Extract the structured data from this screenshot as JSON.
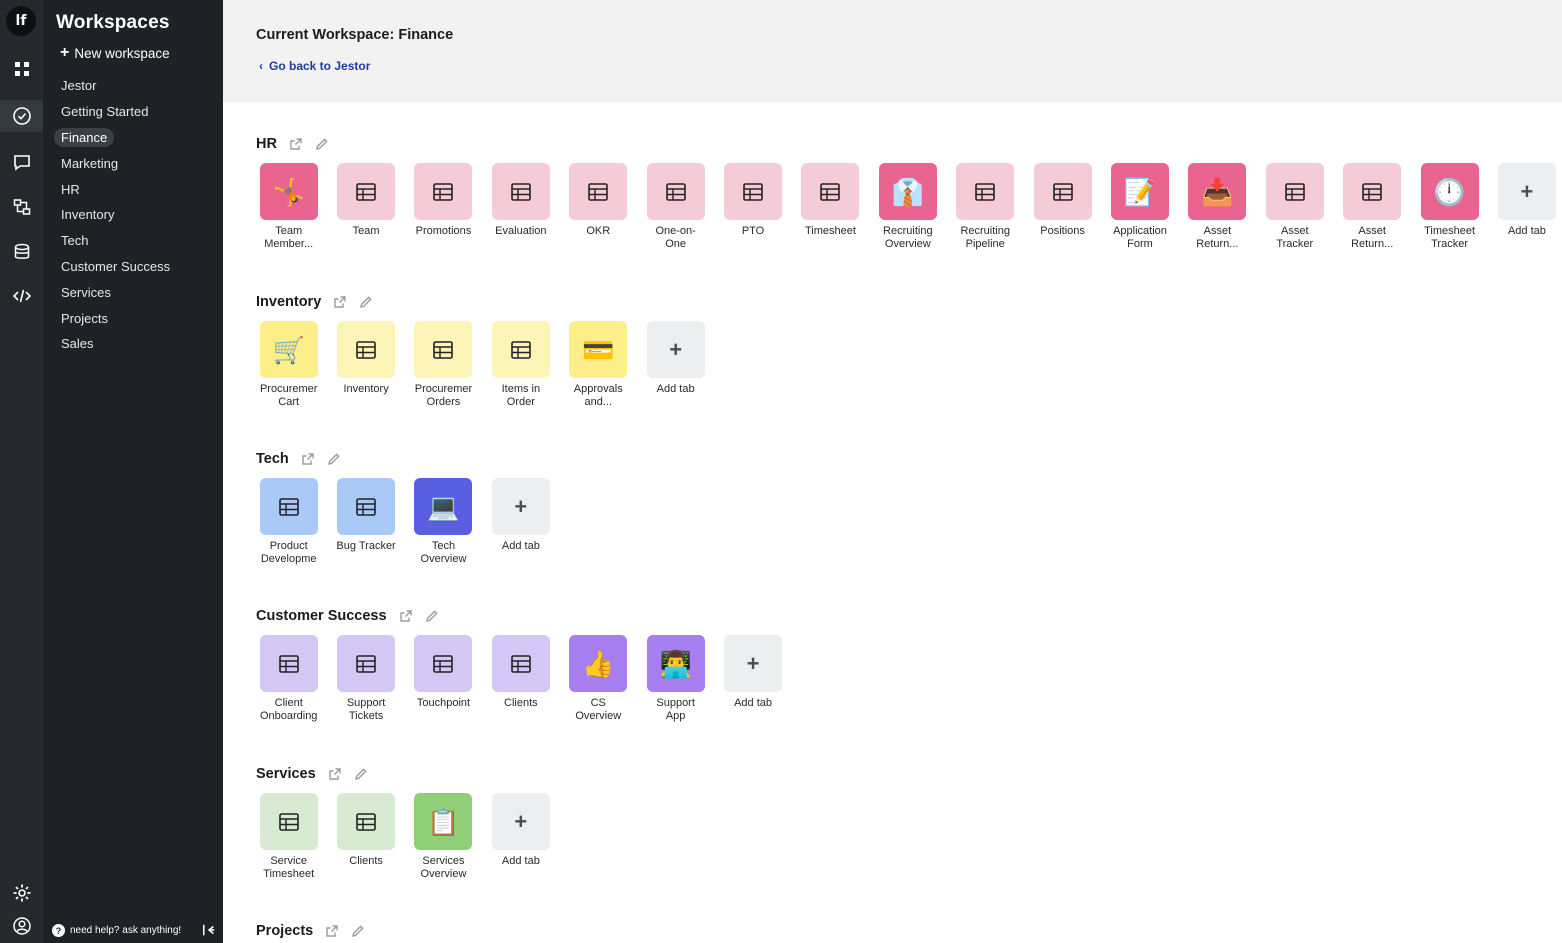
{
  "rail": {
    "logo": "lf",
    "items": [
      {
        "name": "workspaces-icon",
        "active": false
      },
      {
        "name": "tasks-check-icon",
        "active": true
      },
      {
        "name": "chat-icon",
        "active": false
      },
      {
        "name": "automation-icon",
        "active": false
      },
      {
        "name": "database-icon",
        "active": false
      },
      {
        "name": "code-icon",
        "active": false
      }
    ],
    "bottom": [
      {
        "name": "settings-gear-icon"
      },
      {
        "name": "user-profile-icon"
      }
    ]
  },
  "panel": {
    "title": "Workspaces",
    "new_workspace": "New workspace",
    "workspaces": [
      "Jestor",
      "Getting Started",
      "Finance",
      "Marketing",
      "HR",
      "Inventory",
      "Tech",
      "Customer Success",
      "Services",
      "Projects",
      "Sales"
    ],
    "selected": "Finance",
    "help": "need help? ask anything!"
  },
  "header": {
    "current_workspace": "Current Workspace: Finance",
    "back_link": "Go back to Jestor"
  },
  "colors": {
    "hr_light": "#f6cbd8",
    "hr_strong": "#e9648f",
    "inventory_light": "#fdf4b8",
    "inventory_strong": "#fcef8a",
    "tech_light": "#a9c9f7",
    "tech_strong": "#5a5ee0",
    "cs_light": "#d5c7f5",
    "cs_strong": "#a77ff0",
    "services_light": "#d9ead2",
    "services_strong": "#8fcf78",
    "add_tile": "#eceef0"
  },
  "sections": [
    {
      "name": "HR",
      "tabs": [
        {
          "label": "Team Member...",
          "icon": "🤸",
          "style": "strong"
        },
        {
          "label": "Team",
          "icon": "table",
          "style": "light"
        },
        {
          "label": "Promotions",
          "icon": "table",
          "style": "light"
        },
        {
          "label": "Evaluation",
          "icon": "table",
          "style": "light"
        },
        {
          "label": "OKR",
          "icon": "table",
          "style": "light"
        },
        {
          "label": "One-on-One",
          "icon": "table",
          "style": "light"
        },
        {
          "label": "PTO",
          "icon": "table",
          "style": "light"
        },
        {
          "label": "Timesheet",
          "icon": "table",
          "style": "light"
        },
        {
          "label": "Recruiting Overview",
          "icon": "👔",
          "style": "strong"
        },
        {
          "label": "Recruiting Pipeline",
          "icon": "table",
          "style": "light"
        },
        {
          "label": "Positions",
          "icon": "table",
          "style": "light"
        },
        {
          "label": "Application Form",
          "icon": "📝",
          "style": "strong"
        },
        {
          "label": "Asset Return...",
          "icon": "📥",
          "style": "strong"
        },
        {
          "label": "Asset Tracker",
          "icon": "table",
          "style": "light"
        },
        {
          "label": "Asset Return...",
          "icon": "table",
          "style": "light"
        },
        {
          "label": "Timesheet Tracker",
          "icon": "🕛",
          "style": "strong"
        },
        {
          "label": "Add tab",
          "icon": "+",
          "style": "add"
        }
      ]
    },
    {
      "name": "Inventory",
      "tabs": [
        {
          "label": "Procuremer Cart",
          "icon": "🛒",
          "style": "strong"
        },
        {
          "label": "Inventory",
          "icon": "table",
          "style": "light"
        },
        {
          "label": "Procuremer Orders",
          "icon": "table",
          "style": "light"
        },
        {
          "label": "Items in Order",
          "icon": "table",
          "style": "light"
        },
        {
          "label": "Approvals and...",
          "icon": "💳",
          "style": "strong"
        },
        {
          "label": "Add tab",
          "icon": "+",
          "style": "add"
        }
      ]
    },
    {
      "name": "Tech",
      "tabs": [
        {
          "label": "Product Developme",
          "icon": "table",
          "style": "light"
        },
        {
          "label": "Bug Tracker",
          "icon": "table",
          "style": "light"
        },
        {
          "label": "Tech Overview",
          "icon": "💻",
          "style": "strong"
        },
        {
          "label": "Add tab",
          "icon": "+",
          "style": "add"
        }
      ]
    },
    {
      "name": "Customer Success",
      "tabs": [
        {
          "label": "Client Onboarding",
          "icon": "table",
          "style": "light"
        },
        {
          "label": "Support Tickets",
          "icon": "table",
          "style": "light"
        },
        {
          "label": "Touchpoint",
          "icon": "table",
          "style": "light"
        },
        {
          "label": "Clients",
          "icon": "table",
          "style": "light"
        },
        {
          "label": "CS Overview",
          "icon": "👍",
          "style": "strong"
        },
        {
          "label": "Support App",
          "icon": "👨‍💻",
          "style": "strong"
        },
        {
          "label": "Add tab",
          "icon": "+",
          "style": "add"
        }
      ]
    },
    {
      "name": "Services",
      "tabs": [
        {
          "label": "Service Timesheet",
          "icon": "table",
          "style": "light"
        },
        {
          "label": "Clients",
          "icon": "table",
          "style": "light"
        },
        {
          "label": "Services Overview",
          "icon": "📋",
          "style": "strong"
        },
        {
          "label": "Add tab",
          "icon": "+",
          "style": "add"
        }
      ]
    },
    {
      "name": "Projects",
      "tabs": []
    }
  ]
}
